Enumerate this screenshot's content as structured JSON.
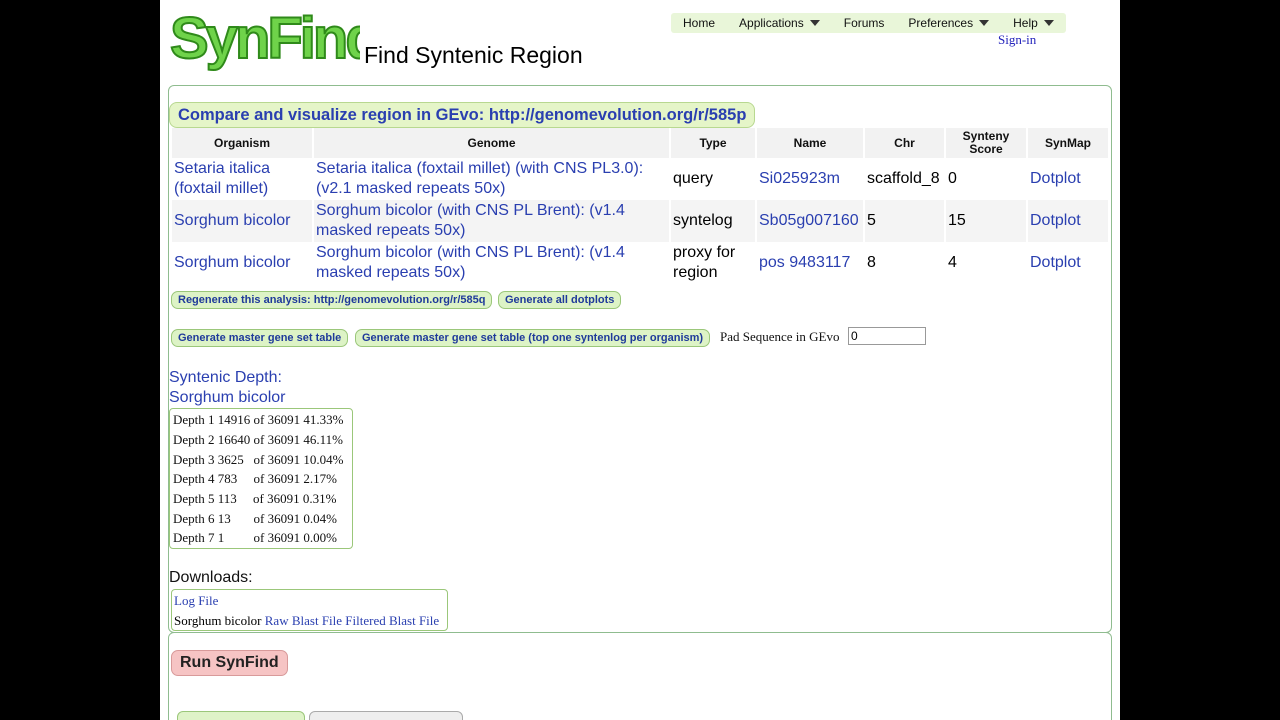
{
  "app": {
    "title": "Find Syntenic Region",
    "logo_text": "SynFind",
    "brand_color": "#4ab82a"
  },
  "nav": {
    "items": [
      {
        "label": "Home",
        "dropdown": false
      },
      {
        "label": "Applications",
        "dropdown": true
      },
      {
        "label": "Forums",
        "dropdown": false
      },
      {
        "label": "Preferences",
        "dropdown": true
      },
      {
        "label": "Help",
        "dropdown": true
      }
    ],
    "signin": "Sign-in"
  },
  "results": {
    "gevo_link": "Compare and visualize region in GEvo: http://genomevolution.org/r/585p",
    "headers": {
      "organism": "Organism",
      "genome": "Genome",
      "type": "Type",
      "name": "Name",
      "chr": "Chr",
      "score_line1": "Synteny",
      "score_line2": "Score",
      "synmap": "SynMap"
    },
    "rows": [
      {
        "organism_l1": "Setaria italica",
        "organism_l2": "(foxtail millet)",
        "genome_l1": "Setaria italica (foxtail millet) (with CNS PL3.0):",
        "genome_l2": "(v2.1 masked repeats 50x)",
        "type_l1": "query",
        "type_l2": "",
        "name": "Si025923m",
        "chr": "scaffold_8",
        "score": "0",
        "synmap": "Dotplot"
      },
      {
        "organism_l1": "Sorghum bicolor",
        "organism_l2": "",
        "genome_l1": "Sorghum bicolor (with CNS PL Brent): (v1.4",
        "genome_l2": "masked repeats 50x)",
        "type_l1": "syntelog",
        "type_l2": "",
        "name": "Sb05g007160",
        "chr": "5",
        "score": "15",
        "synmap": "Dotplot"
      },
      {
        "organism_l1": "Sorghum bicolor",
        "organism_l2": "",
        "genome_l1": "Sorghum bicolor (with CNS PL Brent): (v1.4",
        "genome_l2": "masked repeats 50x)",
        "type_l1": "proxy for",
        "type_l2": "region",
        "name": "pos 9483117",
        "chr": "8",
        "score": "4",
        "synmap": "Dotplot"
      }
    ],
    "regenerate_button": "Regenerate this analysis: http://genomevolution.org/r/585q",
    "dotplots_button": "Generate all dotplots",
    "master_table_button": "Generate master gene set table",
    "master_table_top_button": "Generate master gene set table (top one syntenlog per organism)",
    "pad_label": "Pad Sequence in GEvo",
    "pad_value": "0"
  },
  "depth": {
    "title_l1": "Syntenic Depth:",
    "title_l2": "Sorghum bicolor",
    "rows": [
      "Depth 1 14916 of 36091 41.33%",
      "Depth 2 16640 of 36091 46.11%",
      "Depth 3 3625   of 36091 10.04%",
      "Depth 4 783     of 36091 2.17%",
      "Depth 5 113     of 36091 0.31%",
      "Depth 6 13       of 36091 0.04%",
      "Depth 7 1         of 36091 0.00%"
    ]
  },
  "downloads": {
    "title": "Downloads:",
    "log_file": "Log File",
    "organism": "Sorghum bicolor",
    "raw_blast": "Raw Blast File",
    "filtered_blast": "Filtered Blast File"
  },
  "run": {
    "label": "Run SynFind"
  },
  "tabs": [
    "",
    ""
  ]
}
